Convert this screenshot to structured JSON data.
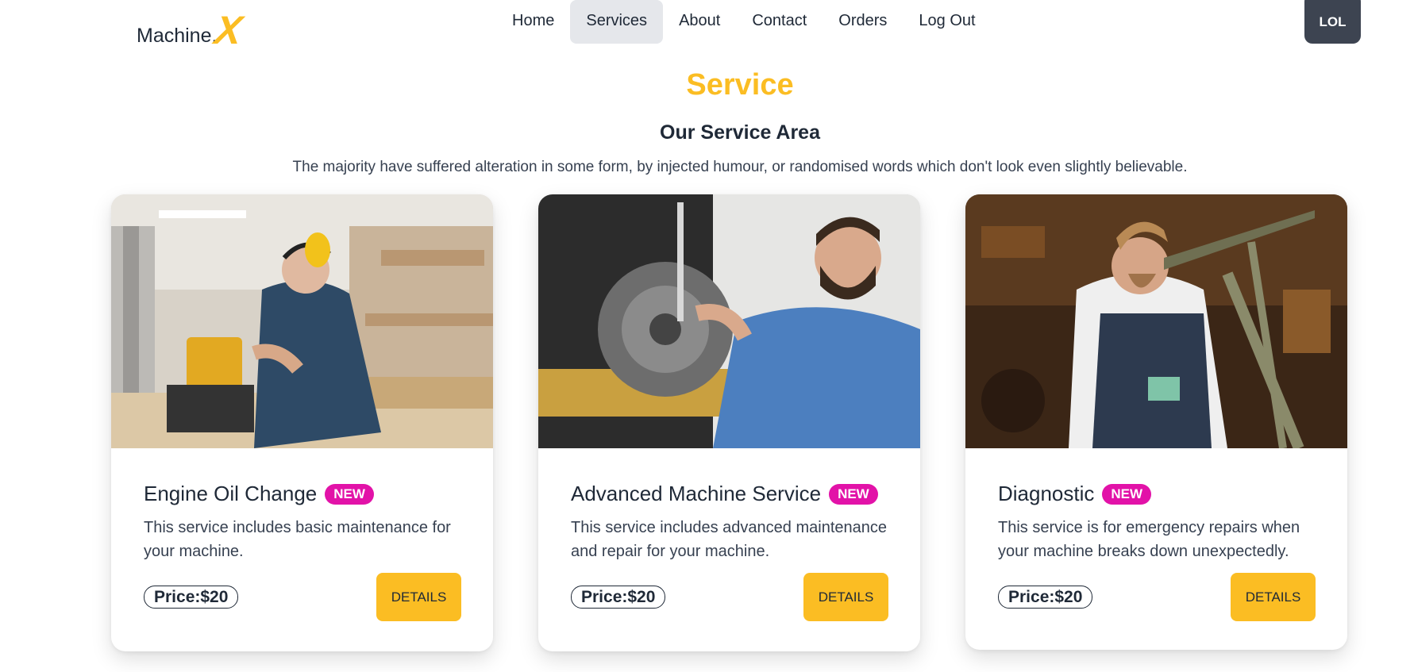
{
  "brand": {
    "name": "Machine.",
    "mark": "X"
  },
  "nav": {
    "items": [
      {
        "label": "Home"
      },
      {
        "label": "Services"
      },
      {
        "label": "About"
      },
      {
        "label": "Contact"
      },
      {
        "label": "Orders"
      },
      {
        "label": "Log Out"
      }
    ],
    "active": "Services",
    "user_button": "LOL"
  },
  "page": {
    "title": "Service",
    "section_title": "Our Service Area",
    "section_desc": "The majority have suffered alteration in some form, by injected humour, or randomised words which don't look even slightly believable."
  },
  "services": [
    {
      "title": "Engine Oil Change",
      "badge": "NEW",
      "description": "This service includes basic maintenance for your machine.",
      "price": "Price:$20",
      "button": "DETAILS",
      "image": "woodworker-with-earmuffs-photo"
    },
    {
      "title": "Advanced Machine Service",
      "badge": "NEW",
      "description": "This service includes advanced maintenance and repair for your machine.",
      "price": "Price:$20",
      "button": "DETAILS",
      "image": "mechanic-measuring-brake-disc-photo"
    },
    {
      "title": "Diagnostic",
      "badge": "NEW",
      "description": "This service is for emergency repairs when your machine breaks down unexpectedly.",
      "price": "Price:$20",
      "button": "DETAILS",
      "image": "bicycle-repairman-photo"
    }
  ],
  "colors": {
    "accent": "#fbbd23",
    "badge": "#e212a8",
    "dark_button": "#3d4451",
    "active_nav": "#e5e7eb"
  }
}
